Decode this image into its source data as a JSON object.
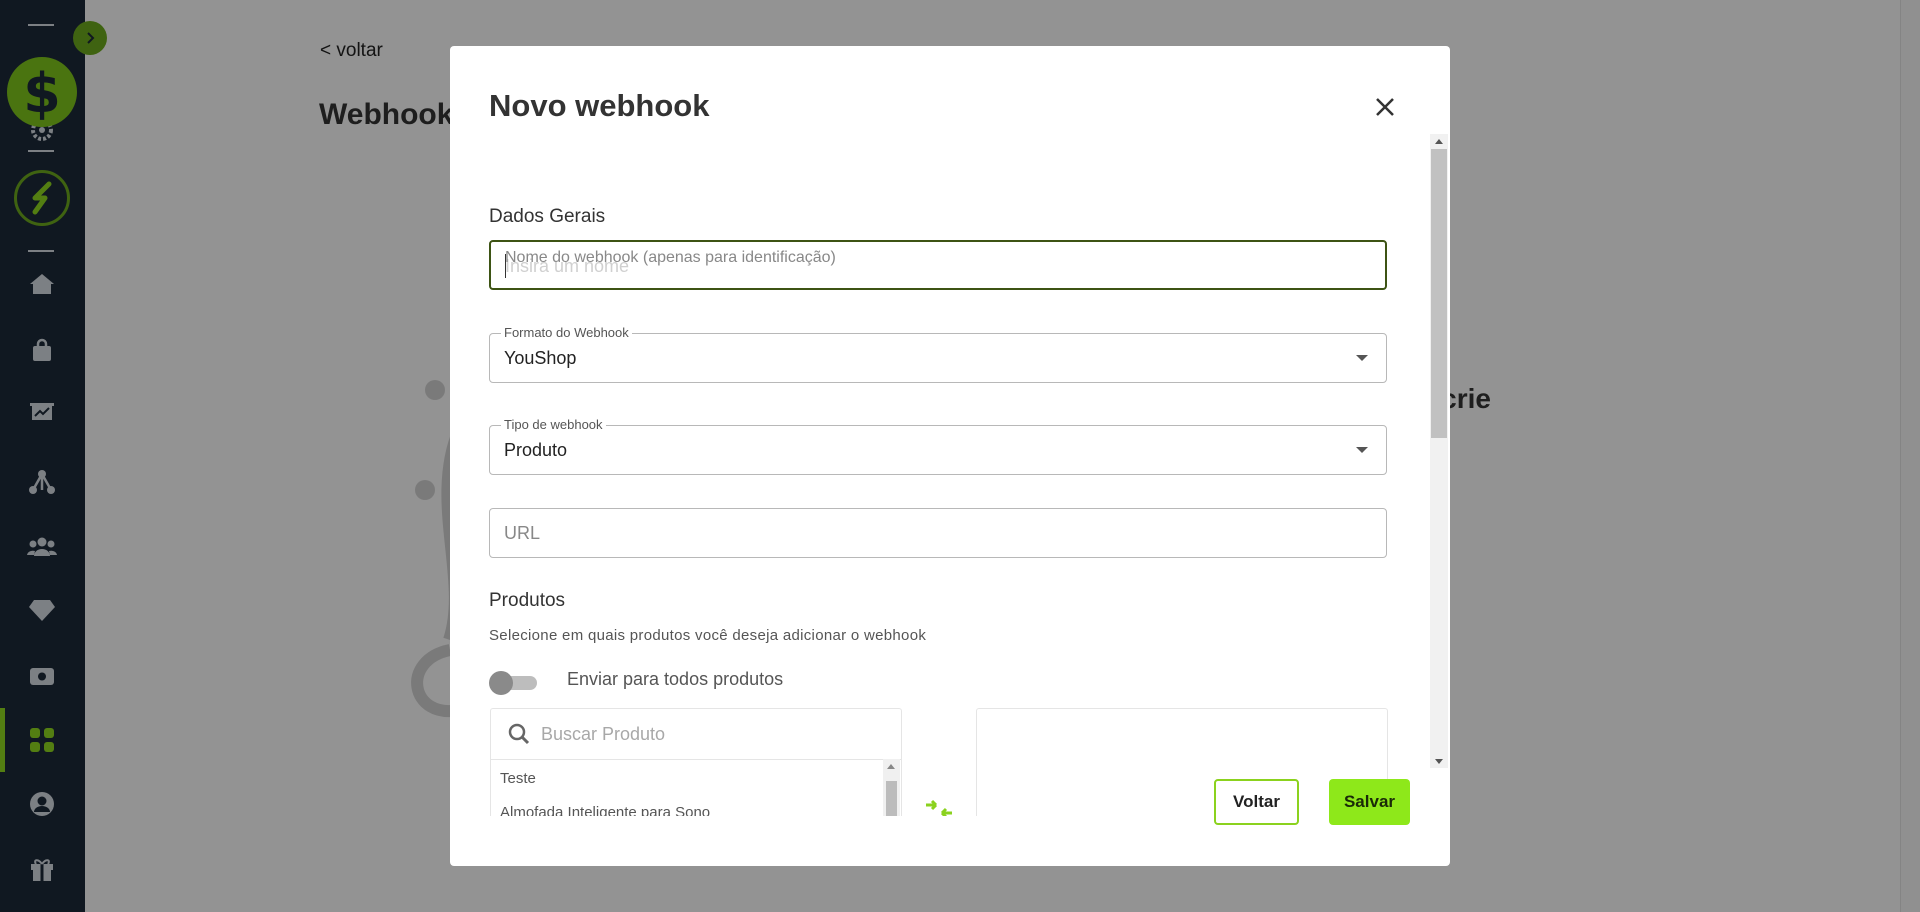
{
  "background_page": {
    "back_link": "< voltar",
    "title": "Webhook",
    "subtitle_fragment": "s, crie"
  },
  "modal": {
    "title": "Novo webhook",
    "general_section_label": "Dados Gerais",
    "name_field": {
      "label": "Nome do webhook (apenas para identificação)",
      "placeholder": "Insira um nome",
      "value": ""
    },
    "format_field": {
      "label": "Formato do Webhook",
      "value": "YouShop"
    },
    "type_field": {
      "label": "Tipo de webhook",
      "value": "Produto"
    },
    "url_field": {
      "placeholder": "URL",
      "value": ""
    },
    "products_section": {
      "label": "Produtos",
      "hint": "Selecione em quais produtos você deseja adicionar o webhook",
      "toggle_label": "Enviar para todos produtos",
      "toggle_on": false,
      "search_placeholder": "Buscar Produto",
      "items": [
        "Teste",
        "Almofada Inteligente para Sono"
      ]
    },
    "buttons": {
      "back": "Voltar",
      "save": "Salvar"
    }
  },
  "colors": {
    "sidebar_bg": "#1c2838",
    "accent_green": "#8bd21e",
    "save_button": "#8ee81a",
    "overlay": "rgba(0,0,0,0.4)"
  },
  "sidebar": {
    "icons": [
      "chevron-right-icon",
      "dollar-logo-icon",
      "gear-icon",
      "brand-s-logo-icon",
      "home-icon",
      "shopping-bag-icon",
      "presentation-chart-icon",
      "network-icon",
      "users-icon",
      "diamond-icon",
      "money-icon",
      "apps-grid-icon",
      "user-circle-icon",
      "gift-icon"
    ],
    "active_item": "apps-grid-icon"
  }
}
